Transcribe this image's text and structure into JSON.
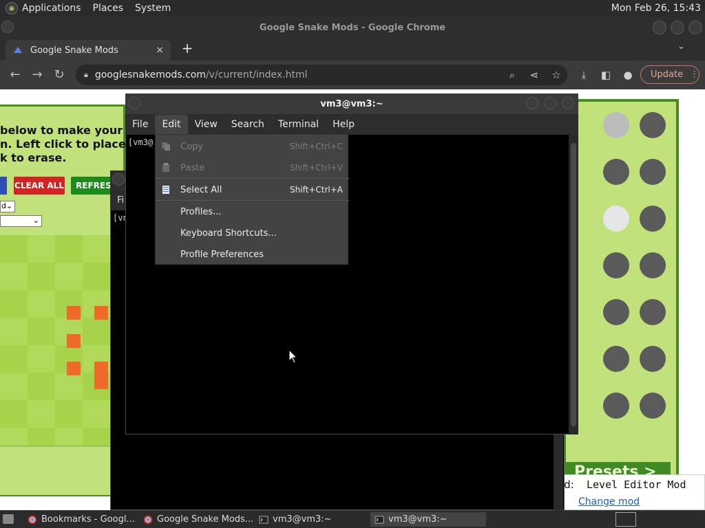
{
  "top_panel": {
    "menus": [
      "Applications",
      "Places",
      "System"
    ],
    "clock": "Mon Feb 26, 15:43"
  },
  "chrome": {
    "window_title": "Google Snake Mods - Google Chrome",
    "tab_title": "Google Snake Mods",
    "tab_close": "×",
    "new_tab": "+",
    "tab_menu": "⌄",
    "url_host": "googlesnakemods.com",
    "url_path": "/v/current/index.html",
    "update_label": "Update"
  },
  "page": {
    "editor_lines": [
      "below to make your own",
      "n. Left click to place an",
      "k to erase."
    ],
    "clear_all_label": "CLEAR ALL",
    "refresh_label": "REFRESH",
    "select1_value": "d",
    "presets_label": "Presets >",
    "mod_label": "od:",
    "mod_name": "Level Editor Mod",
    "change_mod_label": "Change mod"
  },
  "terminal_back": {
    "menu_first": "Fi",
    "prompt": "[vn"
  },
  "terminal": {
    "title": "vm3@vm3:~",
    "menus": [
      "File",
      "Edit",
      "View",
      "Search",
      "Terminal",
      "Help"
    ],
    "prompt": "[vm3@"
  },
  "edit_menu": {
    "items": [
      {
        "label": "Copy",
        "accel": "Shift+Ctrl+C",
        "disabled": true,
        "icon": "copy-icon"
      },
      {
        "label": "Paste",
        "accel": "Shift+Ctrl+V",
        "disabled": true,
        "icon": "paste-icon"
      },
      {
        "label": "Select All",
        "accel": "Shift+Ctrl+A",
        "disabled": false,
        "icon": "select-all-icon"
      },
      {
        "label": "Profiles...",
        "accel": "",
        "disabled": false
      },
      {
        "label": "Keyboard Shortcuts...",
        "accel": "",
        "disabled": false
      },
      {
        "label": "Profile Preferences",
        "accel": "",
        "disabled": false
      }
    ]
  },
  "taskbar": {
    "tasks": [
      "Bookmarks - Googl...",
      "Google Snake Mods...",
      "vm3@vm3:~",
      "vm3@vm3:~"
    ]
  },
  "colors": {
    "editor_green": "#c1e17a",
    "border_green": "#4a8a1f",
    "clear_red": "#d22222",
    "refresh_green": "#1e8a1e",
    "wall_orange": "#ee6a2a"
  }
}
